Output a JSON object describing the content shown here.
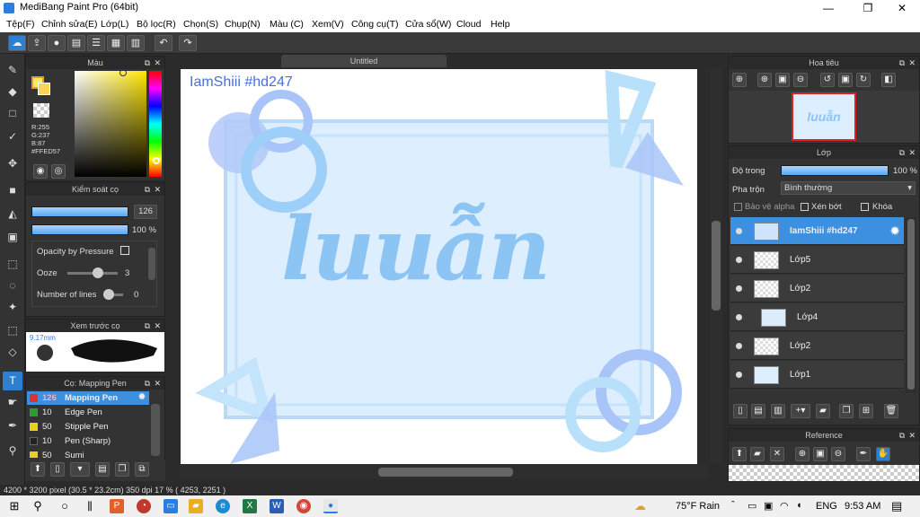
{
  "app": {
    "title": "MediBang Paint Pro (64bit)",
    "minimize": "—",
    "maximize": "❐",
    "close": "✕"
  },
  "menu": [
    "Tệp(F)",
    "Chỉnh sửa(E)",
    "Lớp(L)",
    "Bộ lọc(R)",
    "Chọn(S)",
    "Chụp(N)",
    "Màu (C)",
    "Xem(V)",
    "Công cụ(T)",
    "Cửa sổ(W)",
    "Cloud",
    "Help"
  ],
  "toolbar_icons": [
    "cloud-icon",
    "export-icon",
    "chat-icon",
    "comment-icon",
    "list-icon",
    "grid-icon",
    "undo-icon",
    "redo-icon"
  ],
  "color_panel": {
    "title": "Màu",
    "r": "R:255",
    "g": "G:237",
    "b": "B:87",
    "hex": "#FFED57",
    "primary": "#FFED57"
  },
  "brush_control": {
    "title": "Kiểm soát cọ",
    "size": "126",
    "opacity": "100 %",
    "opacity_pressure": "Opacity by Pressure",
    "ooze_label": "Ooze",
    "ooze_value": "3",
    "lines_label": "Number of lines",
    "lines_value": "0"
  },
  "brush_preview": {
    "title": "Xem trước cọ",
    "size": "9.17mm"
  },
  "brush_list": {
    "title": "Cọ: Mapping Pen",
    "items": [
      {
        "num": "126",
        "label": "Mapping Pen",
        "color": "#e03030"
      },
      {
        "num": "10",
        "label": "Edge Pen",
        "color": "#2e9c2e"
      },
      {
        "num": "50",
        "label": "Stipple Pen",
        "color": "#e8d020"
      },
      {
        "num": "10",
        "label": "Pen (Sharp)",
        "color": "#222222"
      },
      {
        "num": "50",
        "label": "Sumi",
        "color": "#e8d020"
      }
    ]
  },
  "canvas": {
    "tab": "Untitled",
    "watermark": "IamShiii #hd247",
    "art_text": "luuẫn"
  },
  "navigator": {
    "title": "Hoa tiêu",
    "thumb_text": "luuẫn"
  },
  "layers": {
    "title": "Lớp",
    "opacity_label": "Độ trong",
    "opacity_value": "100 %",
    "blend_label": "Pha trộn",
    "blend_value": "Bình thường",
    "protect_alpha": "Bảo vệ alpha",
    "clip": "Xén bớt",
    "lock": "Khóa",
    "items": [
      {
        "name": "IamShiii #hd247"
      },
      {
        "name": "Lớp5"
      },
      {
        "name": "Lớp2"
      },
      {
        "name": "Lớp4"
      },
      {
        "name": "Lớp2"
      },
      {
        "name": "Lớp1"
      }
    ]
  },
  "reference": {
    "title": "Reference"
  },
  "status": "4200 * 3200 pixel  (30.5 * 23.2cm)  350 dpi  17 %  ( 4253, 2251 )",
  "taskbar": {
    "weather": "75°F Rain",
    "lang": "ENG",
    "time": "9:53 AM"
  }
}
